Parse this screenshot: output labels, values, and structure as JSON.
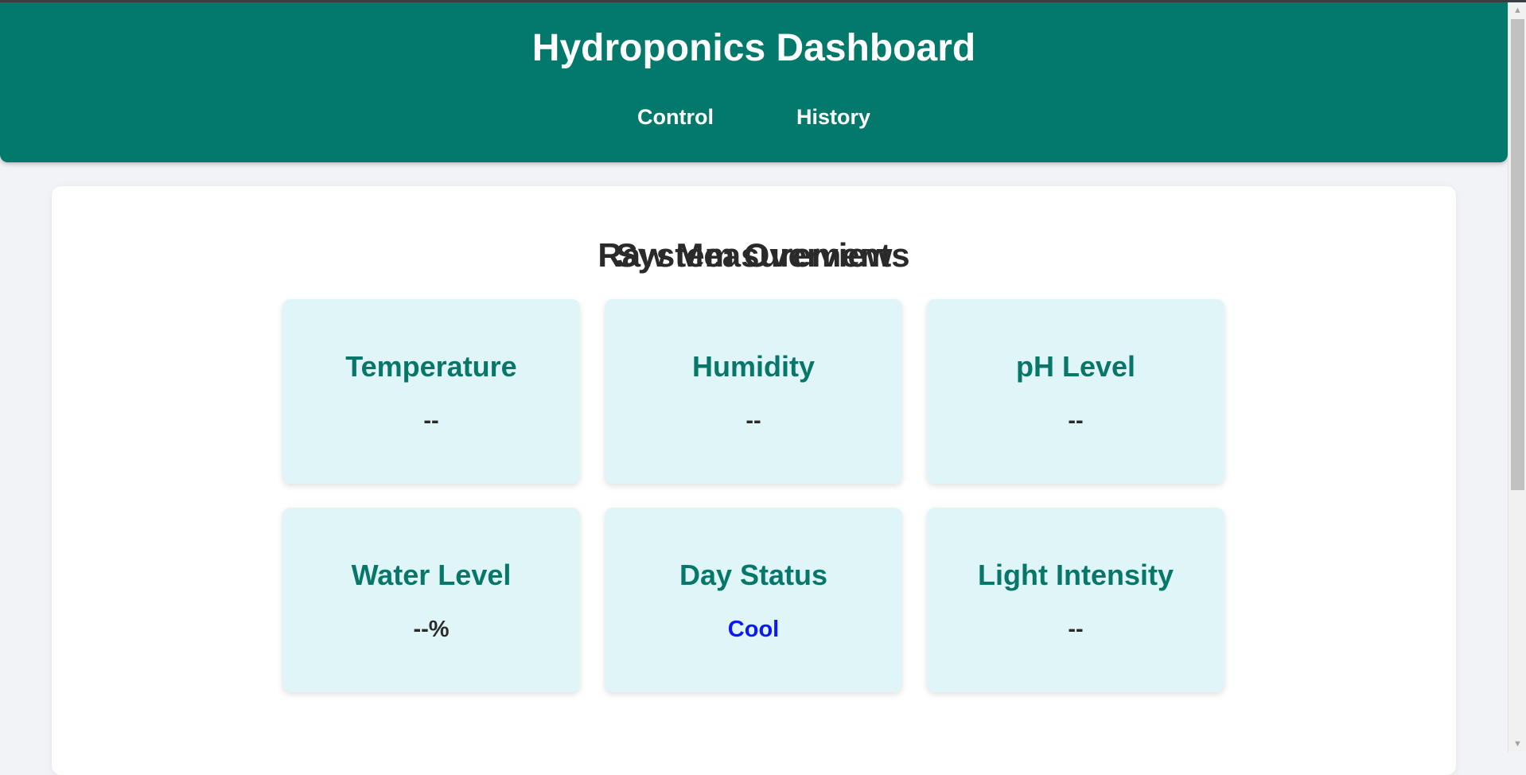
{
  "header": {
    "title": "Hydroponics Dashboard",
    "nav": [
      {
        "label": "Control"
      },
      {
        "label": "History"
      }
    ]
  },
  "main": {
    "overview_title": "System Overview",
    "cards": [
      {
        "title": "Temperature",
        "value": "--"
      },
      {
        "title": "Humidity",
        "value": "--"
      },
      {
        "title": "pH Level",
        "value": "--"
      },
      {
        "title": "Water Level",
        "value": "--%"
      },
      {
        "title": "Day Status",
        "value": "Cool",
        "value_color": "#0a1af0"
      },
      {
        "title": "Light Intensity",
        "value": "--"
      }
    ],
    "next_section_title": "Raw Measurements"
  },
  "colors": {
    "header_bg": "#03796b",
    "card_bg": "#dff5f8",
    "card_title": "#067768",
    "page_bg": "#f2f3f7"
  }
}
